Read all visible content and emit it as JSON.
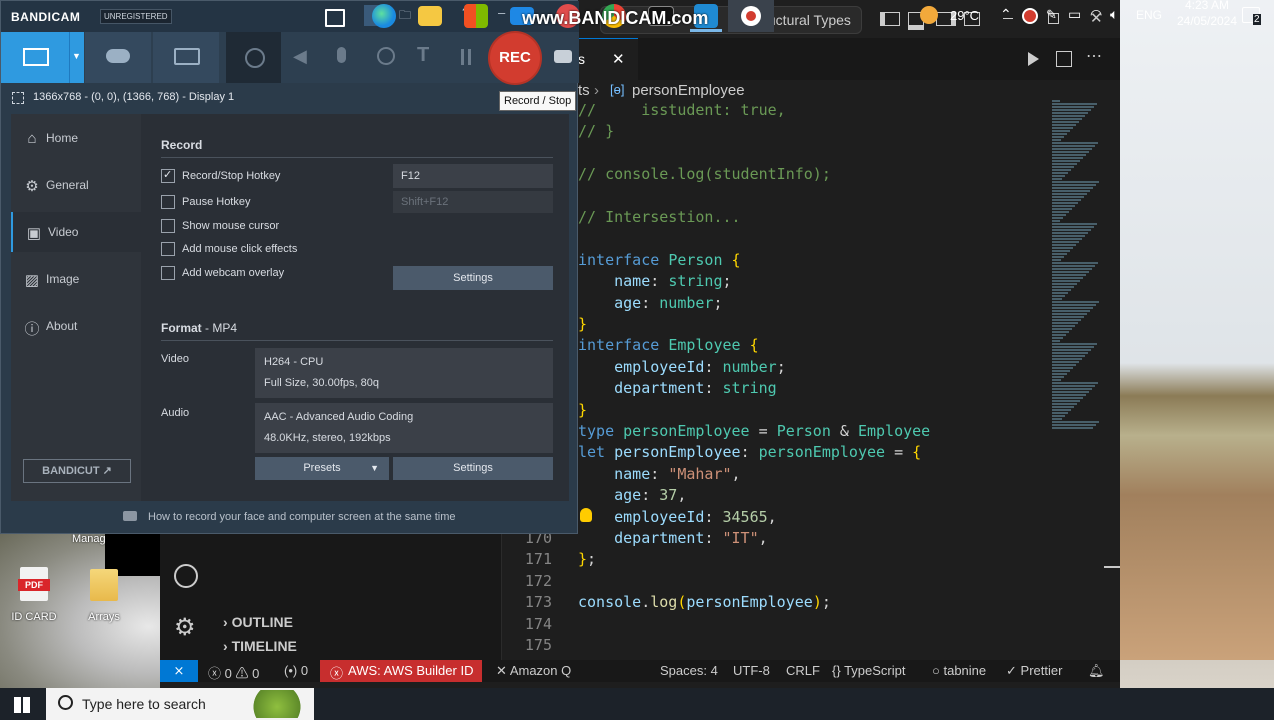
{
  "bandicam": {
    "brand": "BANDICAM",
    "unregistered": "UNREGISTERED",
    "watermark": "www.BANDICAM.com",
    "rec_label": "REC",
    "tooltip": "Record / Stop",
    "region": "1366x768 - (0, 0), (1366, 768) - Display 1",
    "nav": [
      {
        "label": "Home",
        "icon": "home-icon"
      },
      {
        "label": "General",
        "icon": "gear-icon"
      },
      {
        "label": "Video",
        "icon": "video-icon"
      },
      {
        "label": "Image",
        "icon": "image-icon"
      },
      {
        "label": "About",
        "icon": "info-icon"
      }
    ],
    "bandicut_label": "BANDICUT",
    "record_heading": "Record",
    "options": [
      {
        "label": "Record/Stop Hotkey",
        "checked": true
      },
      {
        "label": "Pause Hotkey",
        "checked": false
      },
      {
        "label": "Show mouse cursor",
        "checked": false
      },
      {
        "label": "Add mouse click effects",
        "checked": false
      },
      {
        "label": "Add webcam overlay",
        "checked": false
      }
    ],
    "hotkey_record": "F12",
    "hotkey_pause": "Shift+F12",
    "settings_label": "Settings",
    "format_heading": "Format",
    "format_value": "- MP4",
    "video_label": "Video",
    "video_codec": "H264 - CPU",
    "video_details": "Full Size, 30.00fps, 80q",
    "audio_label": "Audio",
    "audio_codec": "AAC - Advanced Audio Coding",
    "audio_details": "48.0KHz, stereo, 192kbps",
    "presets_label": "Presets",
    "footer_tip": "How to record your face and computer screen at the same time"
  },
  "vscode": {
    "title_tab": "Structural Types",
    "breadcrumb_file": "ts",
    "breadcrumb_symbol": "personEmployee",
    "tab_suffix": "s",
    "code_lines": [
      {
        "n": "",
        "segments": [
          [
            "cm",
            "//     isstudent: true,"
          ]
        ]
      },
      {
        "n": "",
        "segments": [
          [
            "cm",
            "// }"
          ]
        ]
      },
      {
        "n": "",
        "segments": []
      },
      {
        "n": "",
        "segments": [
          [
            "cm",
            "// console.log(studentInfo);"
          ]
        ]
      },
      {
        "n": "",
        "segments": []
      },
      {
        "n": "",
        "segments": [
          [
            "cm",
            "// Intersestion..."
          ]
        ]
      },
      {
        "n": "",
        "segments": []
      },
      {
        "n": "",
        "segments": [
          [
            "kw",
            "interface"
          ],
          [
            "pu",
            " "
          ],
          [
            "ty",
            "Person"
          ],
          [
            "pu",
            " "
          ],
          [
            "br",
            "{"
          ]
        ]
      },
      {
        "n": "",
        "segments": [
          [
            "pu",
            "    "
          ],
          [
            "va",
            "name"
          ],
          [
            "pu",
            ": "
          ],
          [
            "ty",
            "string"
          ],
          [
            "pu",
            ";"
          ]
        ]
      },
      {
        "n": "",
        "segments": [
          [
            "pu",
            "    "
          ],
          [
            "va",
            "age"
          ],
          [
            "pu",
            ": "
          ],
          [
            "ty",
            "number"
          ],
          [
            "pu",
            ";"
          ]
        ]
      },
      {
        "n": "",
        "segments": [
          [
            "br",
            "}"
          ]
        ]
      },
      {
        "n": "",
        "segments": [
          [
            "kw",
            "interface"
          ],
          [
            "pu",
            " "
          ],
          [
            "ty",
            "Employee"
          ],
          [
            "pu",
            " "
          ],
          [
            "br",
            "{"
          ]
        ]
      },
      {
        "n": "",
        "segments": [
          [
            "pu",
            "    "
          ],
          [
            "va",
            "employeeId"
          ],
          [
            "pu",
            ": "
          ],
          [
            "ty",
            "number"
          ],
          [
            "pu",
            ";"
          ]
        ]
      },
      {
        "n": "",
        "segments": [
          [
            "pu",
            "    "
          ],
          [
            "va",
            "department"
          ],
          [
            "pu",
            ": "
          ],
          [
            "ty",
            "string"
          ]
        ]
      },
      {
        "n": "",
        "segments": [
          [
            "br",
            "}"
          ]
        ]
      },
      {
        "n": "",
        "segments": [
          [
            "kw",
            "type"
          ],
          [
            "pu",
            " "
          ],
          [
            "ty",
            "personEmployee"
          ],
          [
            "pu",
            " = "
          ],
          [
            "ty",
            "Person"
          ],
          [
            "pu",
            " & "
          ],
          [
            "ty",
            "Employee"
          ]
        ]
      },
      {
        "n": "",
        "segments": [
          [
            "kw",
            "let"
          ],
          [
            "pu",
            " "
          ],
          [
            "va",
            "personEmployee"
          ],
          [
            "pu",
            ": "
          ],
          [
            "ty",
            "personEmployee"
          ],
          [
            "pu",
            " = "
          ],
          [
            "br",
            "{"
          ]
        ]
      },
      {
        "n": "",
        "segments": [
          [
            "pu",
            "    "
          ],
          [
            "va",
            "name"
          ],
          [
            "pu",
            ": "
          ],
          [
            "st",
            "\"Mahar\""
          ],
          [
            "pu",
            ","
          ]
        ]
      },
      {
        "n": "",
        "segments": [
          [
            "pu",
            "    "
          ],
          [
            "va",
            "age"
          ],
          [
            "pu",
            ": "
          ],
          [
            "nu",
            "37"
          ],
          [
            "pu",
            ","
          ]
        ]
      },
      {
        "n": "",
        "segments": [
          [
            "pu",
            "    "
          ],
          [
            "va",
            "employeeId"
          ],
          [
            "pu",
            ": "
          ],
          [
            "nu",
            "34565"
          ],
          [
            "pu",
            ","
          ]
        ]
      },
      {
        "n": "170",
        "segments": [
          [
            "pu",
            "    "
          ],
          [
            "va",
            "department"
          ],
          [
            "pu",
            ": "
          ],
          [
            "st",
            "\"IT\""
          ],
          [
            "pu",
            ","
          ]
        ]
      },
      {
        "n": "171",
        "segments": [
          [
            "br",
            "}"
          ],
          [
            "pu",
            ";"
          ]
        ]
      },
      {
        "n": "172",
        "segments": []
      },
      {
        "n": "173",
        "segments": [
          [
            "va",
            "console"
          ],
          [
            "pu",
            "."
          ],
          [
            "fn",
            "log"
          ],
          [
            "br",
            "("
          ],
          [
            "va",
            "personEmployee"
          ],
          [
            "br",
            ")"
          ],
          [
            "pu",
            ";"
          ]
        ]
      },
      {
        "n": "174",
        "segments": []
      },
      {
        "n": "175",
        "segments": []
      }
    ],
    "outline": "OUTLINE",
    "timeline": "TIMELINE",
    "status": {
      "errors": "0",
      "warnings": "0",
      "ports": "0",
      "aws": "AWS: AWS Builder ID",
      "amazonq": "Amazon Q",
      "spaces": "Spaces: 4",
      "encoding": "UTF-8",
      "eol": "CRLF",
      "language": "TypeScript",
      "tabnine": "tabnine",
      "prettier": "Prettier"
    }
  },
  "desktop": {
    "manage_label": "Manag",
    "icons": [
      {
        "label": "ID CARD",
        "badge": "PDF"
      },
      {
        "label": "Arrays"
      }
    ]
  },
  "taskbar": {
    "search_placeholder": "Type here to search",
    "weather": "29°C",
    "language": "ENG",
    "time": "4:23 AM",
    "date": "24/05/2024",
    "notification_count": "2",
    "apps": [
      "task-view",
      "edge",
      "file-explorer",
      "store",
      "mail",
      "app-red",
      "chrome",
      "terminal",
      "vscode",
      "bandicam"
    ]
  }
}
